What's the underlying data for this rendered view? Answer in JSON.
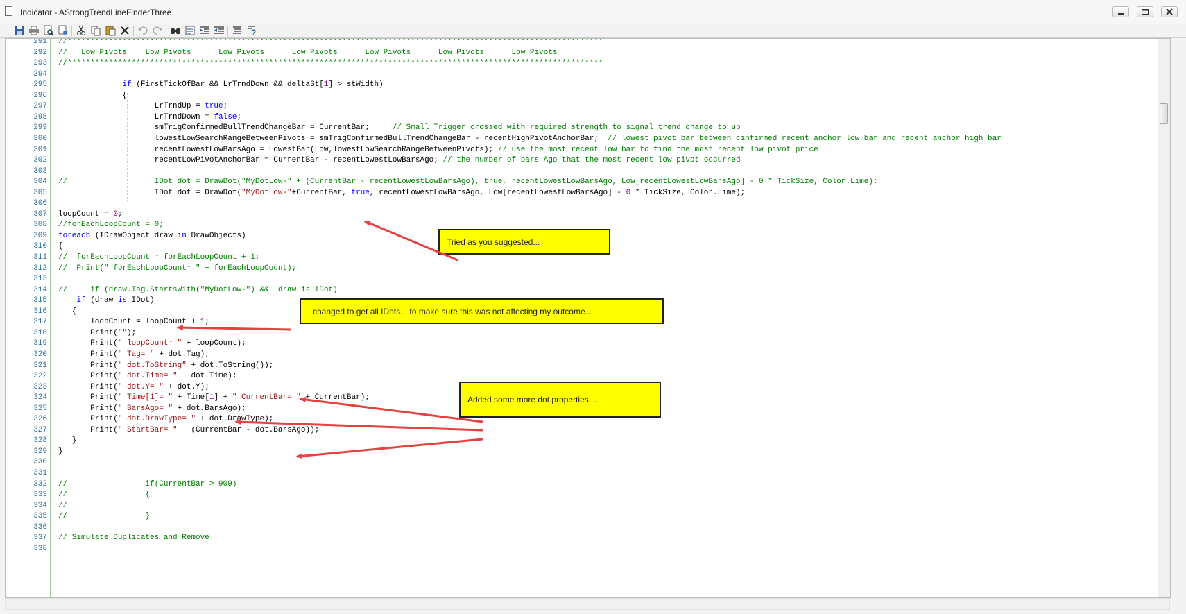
{
  "window": {
    "title": "Indicator - AStrongTrendLineFinderThree"
  },
  "toolbar": {
    "icons": [
      "save-icon",
      "print-icon",
      "print-preview-icon",
      "page-setup-icon",
      "cut-icon",
      "copy-icon",
      "paste-icon",
      "delete-icon",
      "undo-icon",
      "redo-icon",
      "find-icon",
      "replace-icon",
      "indent-icon",
      "outdent-icon",
      "comment-icon",
      "help-icon"
    ]
  },
  "code": {
    "lines": [
      {
        "n": "291",
        "t": "//*********************************************************************************************************************"
      },
      {
        "n": "292",
        "t": "//   Low Pivots    Low Pivots      Low Pivots      Low Pivots      Low Pivots      Low Pivots      Low Pivots"
      },
      {
        "n": "293",
        "t": "//*********************************************************************************************************************"
      },
      {
        "n": "294",
        "t": ""
      },
      {
        "n": "295",
        "t": "              if (FirstTickOfBar && LrTrndDown && deltaSt[1] > stWidth)"
      },
      {
        "n": "296",
        "t": "              {"
      },
      {
        "n": "297",
        "t": "                     LrTrndUp = true;"
      },
      {
        "n": "298",
        "t": "                     LrTrndDown = false;"
      },
      {
        "n": "299",
        "t": "                     smTrigConfirmedBullTrendChangeBar = CurrentBar;     // Small Trigger crossed with required strength to signal trend change to up"
      },
      {
        "n": "300",
        "t": "                     lowestLowSearchRangeBetweenPivots = smTrigConfirmedBullTrendChangeBar - recentHighPivotAnchorBar;  // lowest pivot bar between cinfirmed recent anchor low bar and recent anchor high bar"
      },
      {
        "n": "301",
        "t": "                     recentLowestLowBarsAgo = LowestBar(Low,lowestLowSearchRangeBetweenPivots); // use the most recent low bar to find the most recent low pivot price"
      },
      {
        "n": "302",
        "t": "                     recentLowPivotAnchorBar = CurrentBar - recentLowestLowBarsAgo; // the number of bars Ago that the most recent low pivot occurred"
      },
      {
        "n": "303",
        "t": ""
      },
      {
        "n": "304",
        "t": "//                   IDot dot = DrawDot(\"MyDotLow-\" + (CurrentBar - recentLowestLowBarsAgo), true, recentLowestLowBarsAgo, Low[recentLowestLowBarsAgo] - 0 * TickSize, Color.Lime);"
      },
      {
        "n": "305",
        "t": "                     IDot dot = DrawDot(\"MyDotLow-\"+CurrentBar, true, recentLowestLowBarsAgo, Low[recentLowestLowBarsAgo] - 0 * TickSize, Color.Lime);"
      },
      {
        "n": "306",
        "t": ""
      },
      {
        "n": "307",
        "t": "loopCount = 0;"
      },
      {
        "n": "308",
        "t": "//forEachLoopCount = 0;"
      },
      {
        "n": "309",
        "t": "foreach (IDrawObject draw in DrawObjects)"
      },
      {
        "n": "310",
        "t": "{"
      },
      {
        "n": "311",
        "t": "//  forEachLoopCount = forEachLoopCount + 1;"
      },
      {
        "n": "312",
        "t": "//  Print(\" forEachLoopCount= \" + forEachLoopCount);"
      },
      {
        "n": "313",
        "t": ""
      },
      {
        "n": "314",
        "t": "//     if (draw.Tag.StartsWith(\"MyDotLow-\") &&  draw is IDot)"
      },
      {
        "n": "315",
        "t": "    if (draw is IDot)"
      },
      {
        "n": "316",
        "t": "   {"
      },
      {
        "n": "317",
        "t": "       loopCount = loopCount + 1;"
      },
      {
        "n": "318",
        "t": "       Print(\"\");"
      },
      {
        "n": "319",
        "t": "       Print(\" loopCount= \" + loopCount);"
      },
      {
        "n": "320",
        "t": "       Print(\" Tag= \" + dot.Tag);"
      },
      {
        "n": "321",
        "t": "       Print(\" dot.ToString\" + dot.ToString());"
      },
      {
        "n": "322",
        "t": "       Print(\" dot.Time= \" + dot.Time);"
      },
      {
        "n": "323",
        "t": "       Print(\" dot.Y= \" + dot.Y);"
      },
      {
        "n": "324",
        "t": "       Print(\" Time[1]= \" + Time[1] + \" CurrentBar= \" + CurrentBar);"
      },
      {
        "n": "325",
        "t": "       Print(\" BarsAgo= \" + dot.BarsAgo);"
      },
      {
        "n": "326",
        "t": "       Print(\" dot.DrawType= \" + dot.DrawType);"
      },
      {
        "n": "327",
        "t": "       Print(\" StartBar= \" + (CurrentBar - dot.BarsAgo));"
      },
      {
        "n": "328",
        "t": "   }"
      },
      {
        "n": "329",
        "t": "}"
      },
      {
        "n": "330",
        "t": ""
      },
      {
        "n": "331",
        "t": ""
      },
      {
        "n": "332",
        "t": "//                 if(CurrentBar > 909)"
      },
      {
        "n": "333",
        "t": "//                 {"
      },
      {
        "n": "334",
        "t": "//"
      },
      {
        "n": "335",
        "t": "//                 }"
      },
      {
        "n": "336",
        "t": ""
      },
      {
        "n": "337",
        "t": "// Simulate Duplicates and Remove"
      },
      {
        "n": "338",
        "t": ""
      }
    ]
  },
  "annotations": {
    "note1": "Tried as you suggested...",
    "note2": "changed to get all IDots... to make sure this was not affecting my outcome...",
    "note3": "Added some more dot properties...."
  },
  "colors": {
    "arrow": "#e64040",
    "note_bg": "#ffff00",
    "comment": "#008000",
    "keyword": "#0000ff",
    "string": "#a31515",
    "number": "#800080",
    "line_number": "#2d6e9a"
  }
}
